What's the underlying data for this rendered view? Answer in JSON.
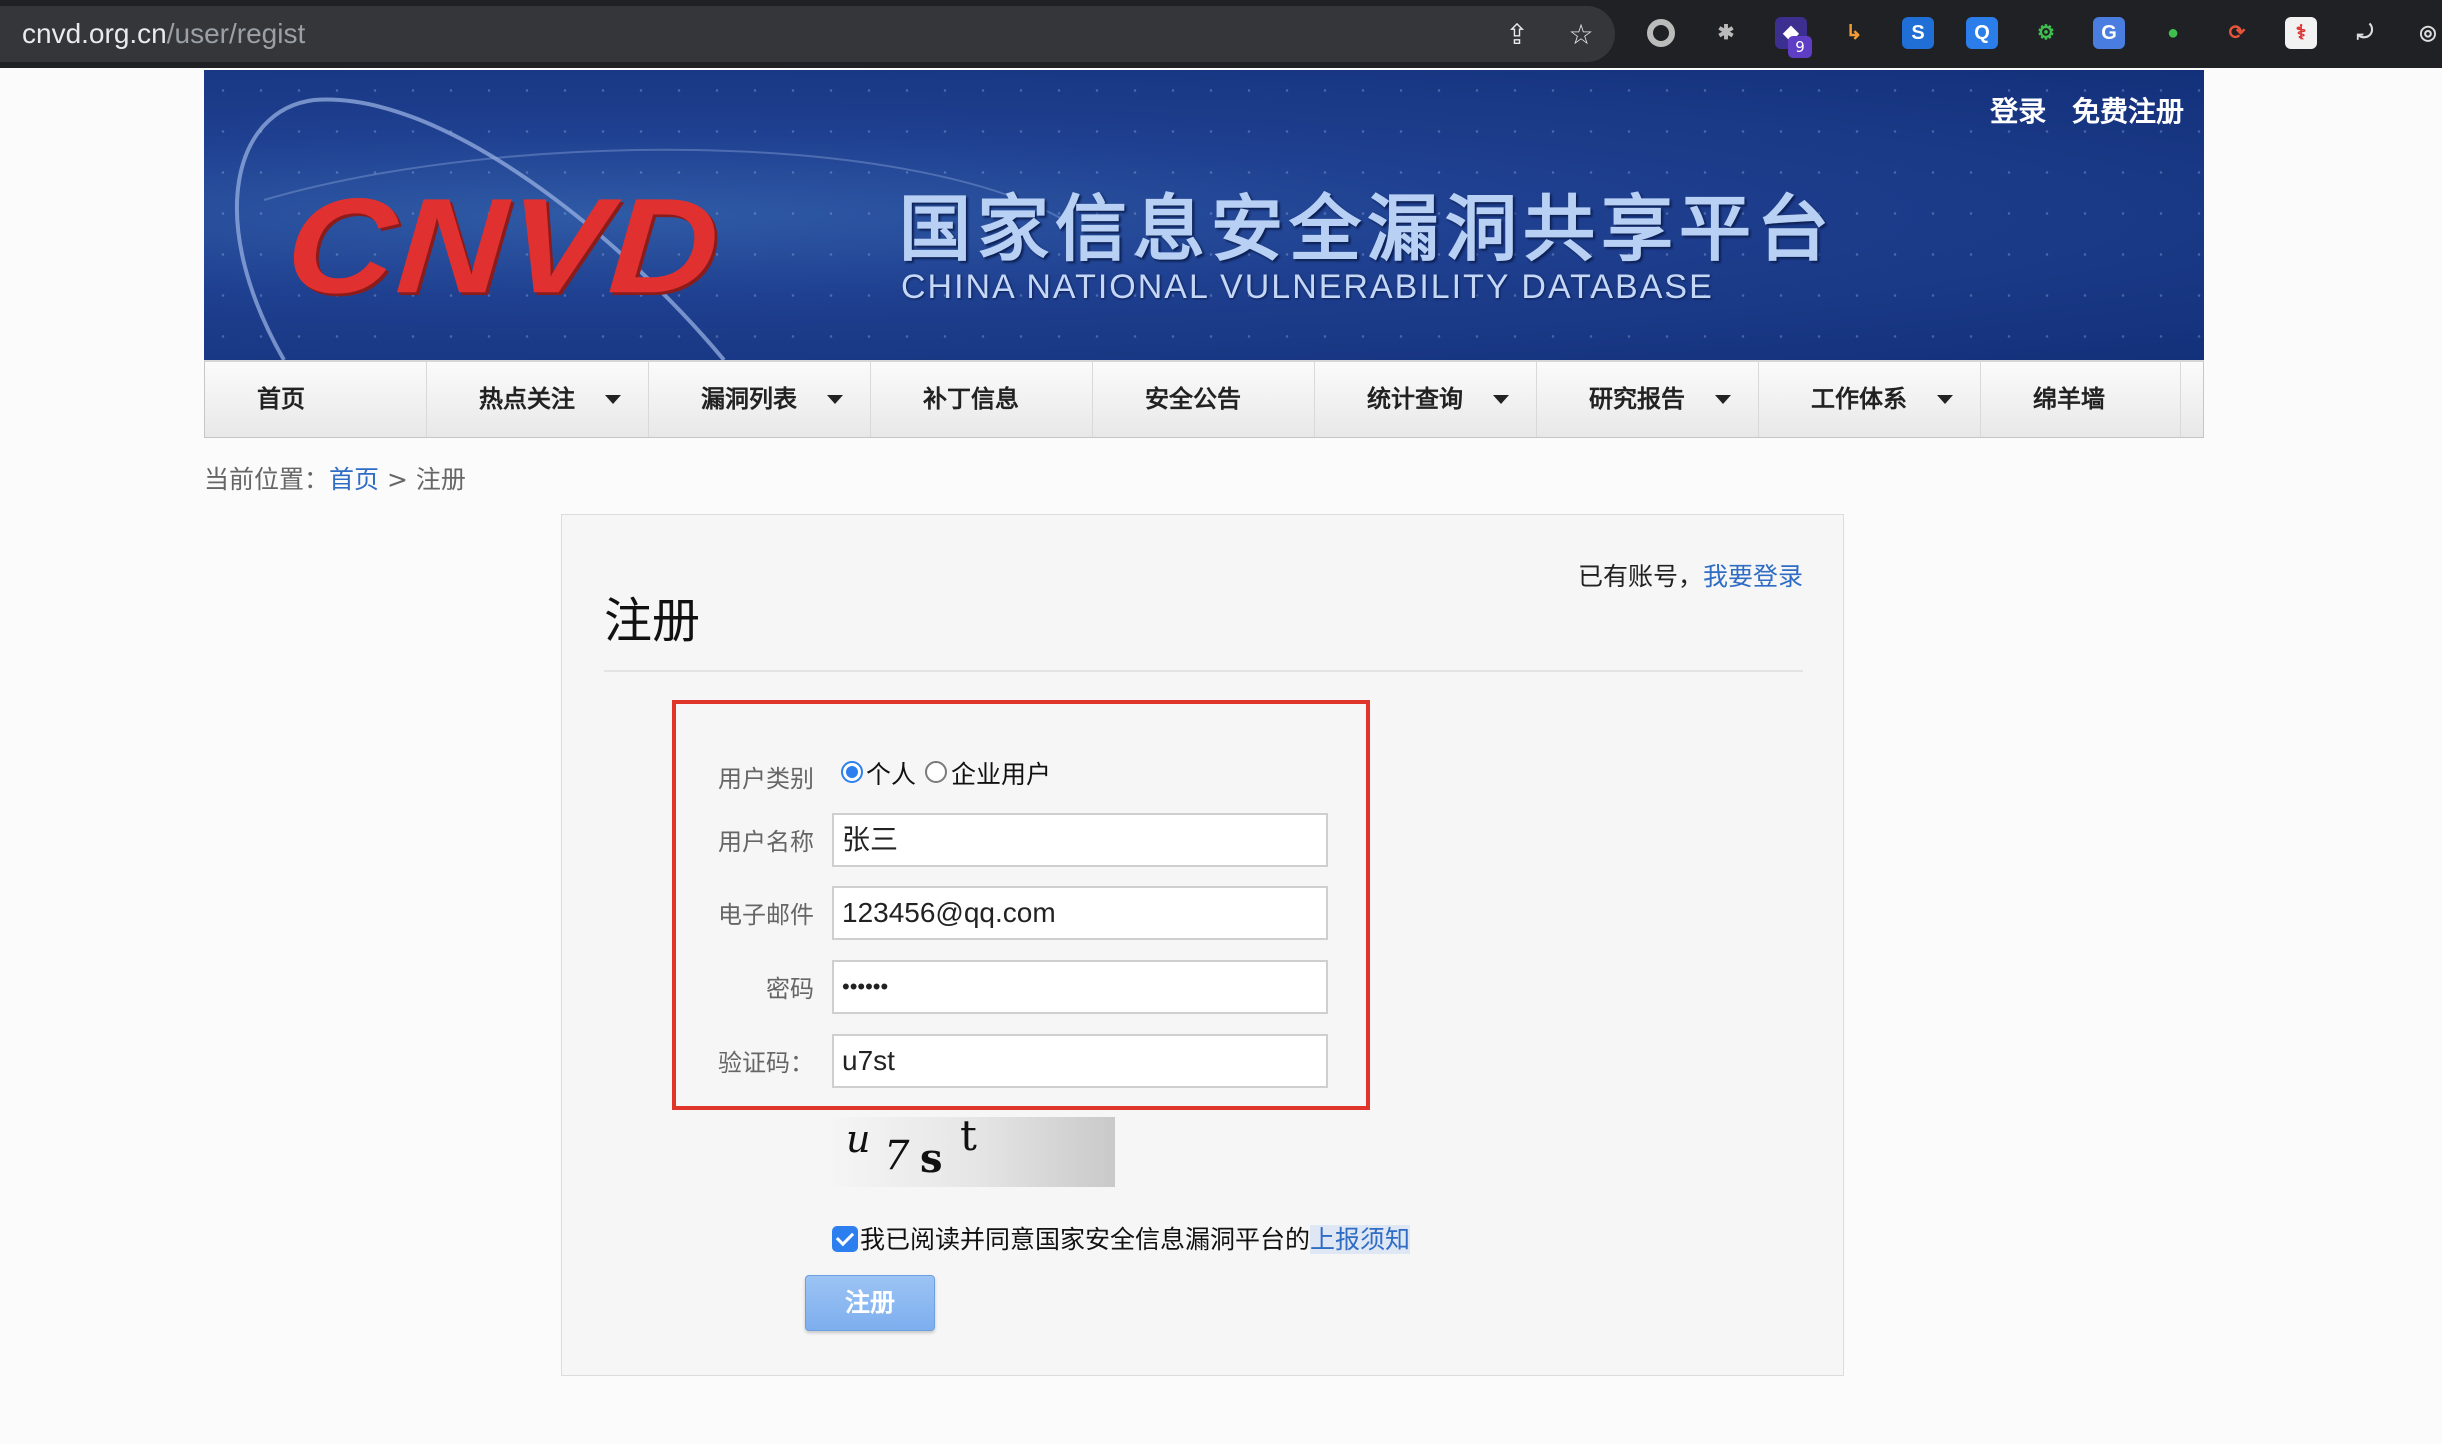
{
  "browser": {
    "url_host": "cnvd.org.cn",
    "url_path": "/user/regist",
    "extension_badge": "9"
  },
  "header": {
    "logo_text": "CNVD",
    "title_cn": "国家信息安全漏洞共享平台",
    "title_en": "CHINA NATIONAL VULNERABILITY DATABASE",
    "login_link": "登录",
    "register_link": "免费注册"
  },
  "nav": {
    "items": [
      {
        "label": "首页"
      },
      {
        "label": "热点关注"
      },
      {
        "label": "漏洞列表"
      },
      {
        "label": "补丁信息"
      },
      {
        "label": "安全公告"
      },
      {
        "label": "统计查询"
      },
      {
        "label": "研究报告"
      },
      {
        "label": "工作体系"
      },
      {
        "label": "绵羊墙"
      }
    ]
  },
  "breadcrumb": {
    "prefix": "当前位置：",
    "home": "首页",
    "separator": " > ",
    "current": "注册"
  },
  "form": {
    "title": "注册",
    "has_account_text": "已有账号，",
    "login_link": "我要登录",
    "user_type_label": "用户类别",
    "user_type_options": [
      "个人",
      "企业用户"
    ],
    "user_type_selected": "个人",
    "username_label": "用户名称",
    "username_value": "张三",
    "email_label": "电子邮件",
    "email_value": "123456@qq.com",
    "password_label": "密码",
    "password_value": "••••••",
    "captcha_label": "验证码：",
    "captcha_value": "u7st",
    "captcha_image_chars": [
      "u",
      "7",
      "s",
      "t"
    ],
    "agree_checked": true,
    "agree_text": "我已阅读并同意国家安全信息漏洞平台的",
    "agree_link": "上报须知",
    "submit_label": "注册"
  },
  "colors": {
    "link": "#2f6cc4",
    "highlight_border": "#e0352b",
    "logo_red": "#e03030",
    "banner_blue": "#1f4090",
    "accent": "#2d7ff0"
  }
}
